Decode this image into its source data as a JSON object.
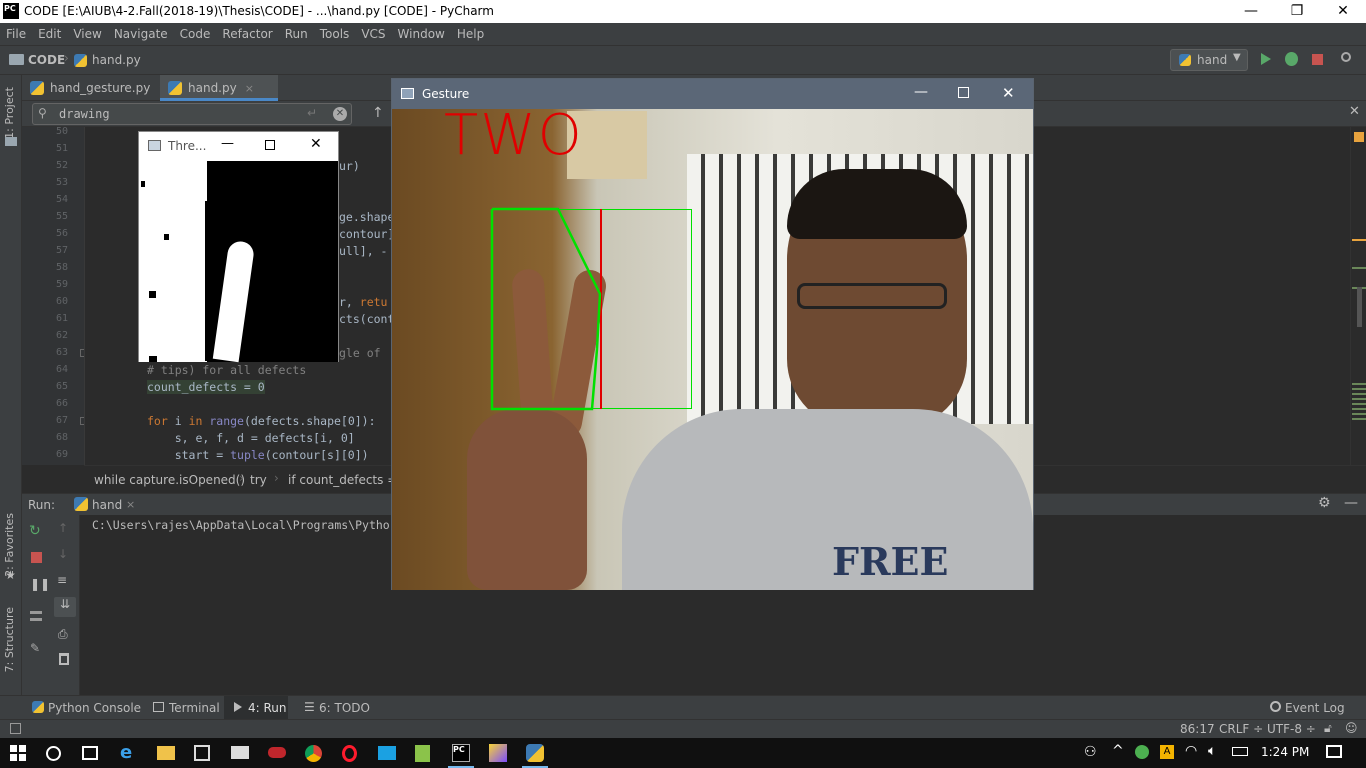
{
  "window": {
    "title": "CODE [E:\\AIUB\\4-2.Fall(2018-19)\\Thesis\\CODE] - ...\\hand.py [CODE] - PyCharm",
    "minimize": "—",
    "restore": "❐",
    "close": "✕"
  },
  "menu": [
    "File",
    "Edit",
    "View",
    "Navigate",
    "Code",
    "Refactor",
    "Run",
    "Tools",
    "VCS",
    "Window",
    "Help"
  ],
  "nav": {
    "project": "CODE",
    "file": "hand.py",
    "run_config": "hand"
  },
  "left_tabs": {
    "project": "1: Project",
    "favorites": "2: Favorites",
    "structure": "7: Structure"
  },
  "tabs": [
    {
      "label": "hand_gesture.py",
      "close": "×"
    },
    {
      "label": "hand.py",
      "close": "×"
    }
  ],
  "search": {
    "value": "drawing"
  },
  "line_numbers": [
    "50",
    "51",
    "52",
    "53",
    "54",
    "55",
    "56",
    "57",
    "58",
    "59",
    "60",
    "61",
    "62",
    "63",
    "64",
    "65",
    "66",
    "67",
    "68",
    "69"
  ],
  "code_frag": {
    "l52": "ur)",
    "l55": "ge.shape",
    "l56": "contour]",
    "l57": "ull], -",
    "l60a": "r, ",
    "l60b": "retu",
    "l61": "cts(cont",
    "l63": "gle of",
    "l64": "# tips) for all defects",
    "l65": "count_defects = 0",
    "l67a": "for",
    "l67b": " i ",
    "l67c": "in",
    "l67d": " ",
    "l67e": "range",
    "l67f": "(defects.shape[0]):",
    "l68": "    s, e, f, d = defects[i, 0]",
    "l69a": "    start = ",
    "l69b": "tuple",
    "l69c": "(contour[s][0])"
  },
  "breadcrumbs": [
    "while capture.isOpened()",
    "try",
    "if count_defects =="
  ],
  "run": {
    "label": "Run:",
    "config": "hand",
    "output": "C:\\Users\\rajes\\AppData\\Local\\Programs\\Pytho"
  },
  "bottom_tabs": [
    "Python Console",
    "Terminal",
    "4: Run",
    "6: TODO"
  ],
  "event_log": "Event Log",
  "status": {
    "position": "86:17",
    "line_sep": "CRLF ÷",
    "encoding": "UTF-8 ÷"
  },
  "gesture_window": {
    "title": "Gesture",
    "overlay_text": "TWO"
  },
  "threshold_window": {
    "title": "Thre..."
  },
  "taskbar": {
    "time": "1:24 PM"
  },
  "colors": {
    "accent_green": "#00e000",
    "overlay_red": "#e00000",
    "titlebar_gesture": "#5b6777"
  }
}
